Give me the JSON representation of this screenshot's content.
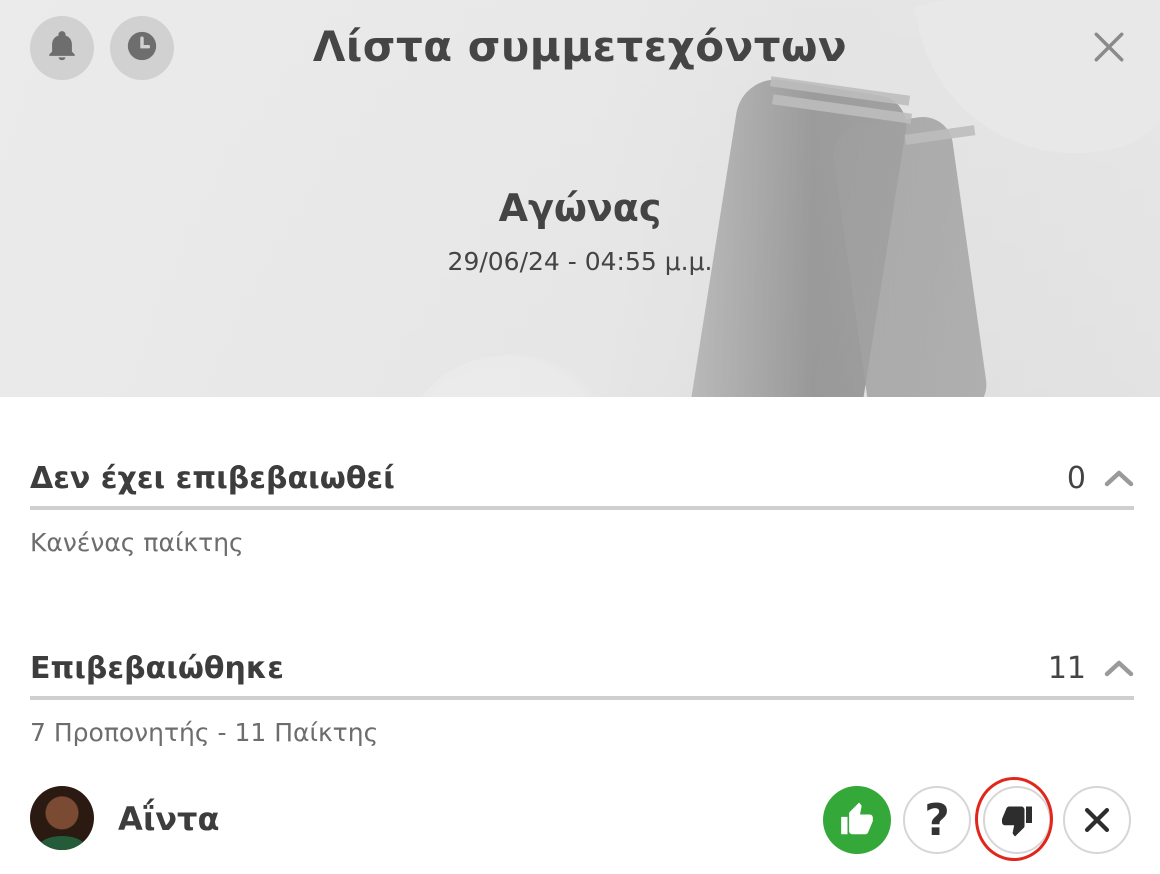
{
  "header": {
    "title": "Λίστα συμμετεχόντων",
    "event_name": "Αγώνας",
    "event_datetime": "29/06/24 - 04:55 μ.μ.",
    "left_icons": [
      "bell-icon",
      "clock-icon"
    ],
    "close_icon": "close-icon"
  },
  "sections": {
    "unconfirmed": {
      "title": "Δεν έχει επιβεβαιωθεί",
      "count": "0",
      "subtitle": "Κανένας παίκτης"
    },
    "confirmed": {
      "title": "Επιβεβαιώθηκε",
      "count": "11",
      "subtitle": "7 Προπονητής - 11 Παίκτης"
    }
  },
  "player": {
    "name": "Αΐντα",
    "actions": {
      "maybe_label": "?",
      "selected": "thumbs-up"
    }
  },
  "colors": {
    "accent_green": "#35a83a",
    "highlight_red": "#e1261c"
  }
}
